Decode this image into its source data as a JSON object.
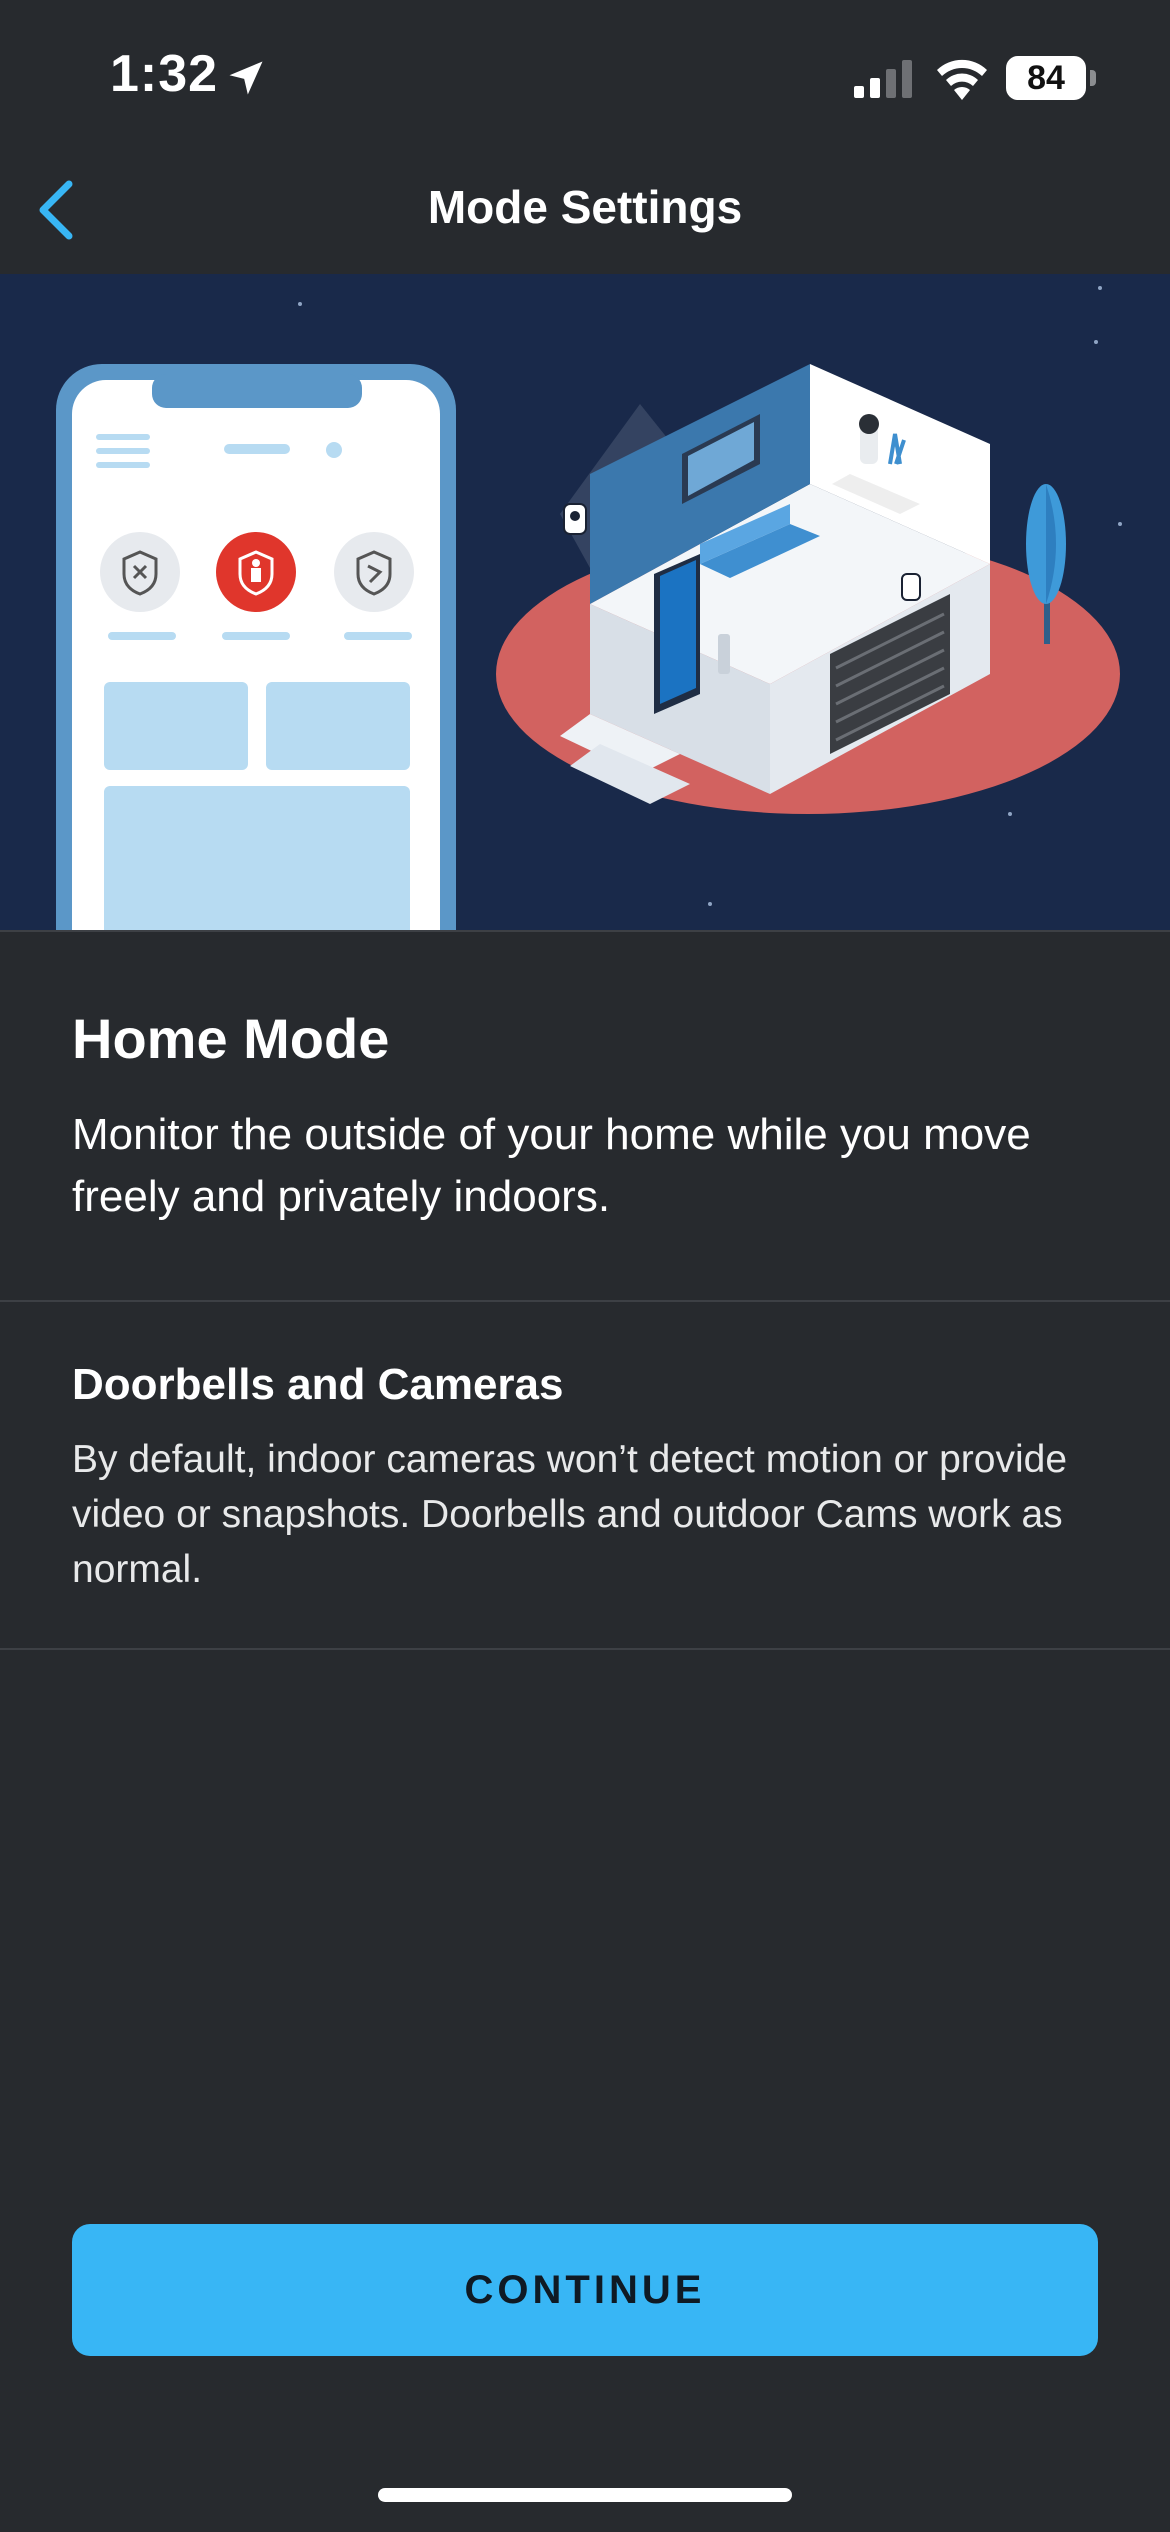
{
  "status_bar": {
    "time": "1:32",
    "battery": "84",
    "icons": [
      "location-arrow-icon",
      "cellular-signal-icon",
      "wifi-icon",
      "battery-icon"
    ]
  },
  "nav": {
    "title": "Mode Settings",
    "back_icon": "chevron-left-icon"
  },
  "hero": {
    "description_icons": [
      "phone-illustration",
      "house-illustration",
      "disarmed-shield-icon",
      "home-shield-icon",
      "away-shield-icon"
    ]
  },
  "mode": {
    "title": "Home Mode",
    "description": "Monitor the outside of your home while you move freely and privately indoors."
  },
  "section": {
    "title": "Doorbells and Cameras",
    "description": "By default, indoor cameras won’t detect motion or provide video or snapshots. Doorbells and outdoor Cams work as normal."
  },
  "actions": {
    "continue_label": "CONTINUE"
  },
  "colors": {
    "background": "#272a2e",
    "accent": "#38b6f5",
    "hero_bg": "#19294a",
    "active_mode": "#e0362c"
  }
}
